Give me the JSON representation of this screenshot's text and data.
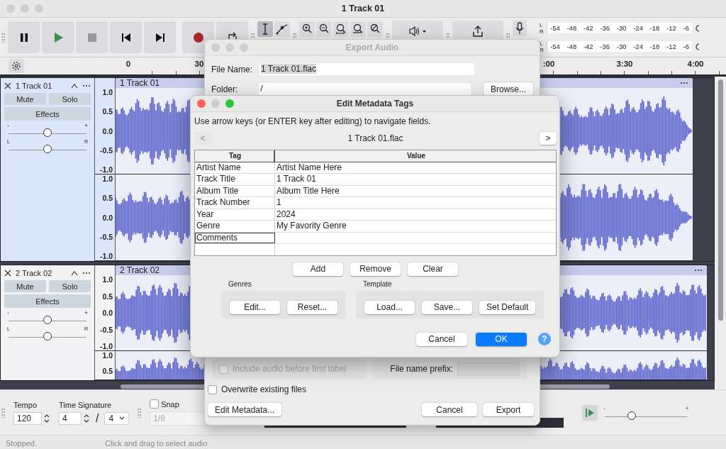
{
  "window": {
    "title": "1 Track 01"
  },
  "toolbar": {
    "transport": [
      {
        "kind": "pause"
      },
      {
        "kind": "play"
      },
      {
        "kind": "stop"
      },
      {
        "kind": "skip-start"
      },
      {
        "kind": "skip-end"
      },
      {
        "kind": "record"
      },
      {
        "kind": "loop"
      }
    ],
    "tools": [
      {
        "kind": "ibeam",
        "selected": true
      },
      {
        "kind": "envelope",
        "selected": false
      }
    ],
    "zoom": [
      {
        "kind": "zoom-in"
      },
      {
        "kind": "zoom-out"
      },
      {
        "kind": "fit-selection"
      },
      {
        "kind": "fit-project"
      },
      {
        "kind": "zoom-toggle"
      }
    ],
    "meters": [
      {
        "channels": [
          "L",
          "R"
        ],
        "scale": [
          "-54",
          "-48",
          "-42",
          "-36",
          "-30",
          "-24",
          "-18",
          "-12",
          "-6"
        ]
      },
      {
        "channels": [
          "L",
          "R"
        ],
        "scale": [
          "-54",
          "-48",
          "-42",
          "-36",
          "-30",
          "-24",
          "-18",
          "-12",
          "-6"
        ]
      }
    ]
  },
  "ruler": {
    "labels": [
      "0",
      "30",
      ":00",
      "3:30",
      "4:00"
    ]
  },
  "tracks": [
    {
      "name": "1 Track 01",
      "selected": true,
      "buttons": [
        "Mute",
        "Solo",
        "Effects"
      ],
      "gain_slider": {
        "min_label": "-",
        "max_label": "+",
        "level": 0.5
      },
      "pan_slider": {
        "min_label": "L",
        "max_label": "R",
        "level": 0.5
      },
      "clip_title": "1 Track 01",
      "channels": [
        {
          "scale": [
            "1.0",
            "0.5",
            "0.0",
            "-0.5",
            "-1.0"
          ]
        },
        {
          "scale": [
            "1.0",
            "0.5",
            "0.0",
            "-0.5",
            "-1.0"
          ]
        }
      ]
    },
    {
      "name": "2 Track 02",
      "selected": false,
      "buttons": [
        "Mute",
        "Solo",
        "Effects"
      ],
      "gain_slider": {
        "min_label": "-",
        "max_label": "+",
        "level": 0.5
      },
      "pan_slider": {
        "min_label": "L",
        "max_label": "R",
        "level": 0.5
      },
      "clip_title": "2 Track 02",
      "channels": [
        {
          "scale": [
            "1.0",
            "0.5",
            "0.0",
            "-0.5",
            "-1.0"
          ]
        },
        {
          "scale": [
            "1.0",
            "0.5"
          ]
        }
      ]
    }
  ],
  "bottom_bar": {
    "tempo": {
      "label": "Tempo",
      "value": "120"
    },
    "time_signature": {
      "label": "Time Signature",
      "upper": "4",
      "separator": "/",
      "lower": "4"
    },
    "snap": {
      "label": "Snap",
      "checked": false,
      "value": "1/8",
      "disabled": true
    },
    "play_speed": {
      "min_label": "-",
      "max_label": "+",
      "level": 0.33
    }
  },
  "status_bar": {
    "state": "Stopped.",
    "hint": "Click and drag to select audio"
  },
  "export_dialog": {
    "title": "Export Audio",
    "file_name_label": "File Name:",
    "file_name": "1 Track 01.flac",
    "folder_label": "Folder:",
    "folder": "/",
    "browse": "Browse...",
    "include_audio": {
      "label": "Include audio before first label",
      "checked": false,
      "disabled": true
    },
    "prefix_label": "File name prefix:",
    "overwrite": {
      "label": "Overwrite existing files",
      "checked": false
    },
    "edit_metadata": "Edit Metadata...",
    "cancel": "Cancel",
    "export": "Export"
  },
  "metadata_dialog": {
    "title": "Edit Metadata Tags",
    "hint": "Use arrow keys (or ENTER key after editing) to navigate fields.",
    "prev": {
      "label": "<",
      "disabled": true
    },
    "file": "1 Track 01.flac",
    "next": {
      "label": ">",
      "disabled": false
    },
    "columns": [
      "Tag",
      "Value"
    ],
    "rows": [
      {
        "tag": "Artist Name",
        "value": "Artist Name Here",
        "selected": false
      },
      {
        "tag": "Track Title",
        "value": "1 Track 01",
        "selected": false
      },
      {
        "tag": "Album Title",
        "value": "Album Title Here",
        "selected": false
      },
      {
        "tag": "Track Number",
        "value": "1",
        "selected": false
      },
      {
        "tag": "Year",
        "value": "2024",
        "selected": false
      },
      {
        "tag": "Genre",
        "value": "My Favority Genre",
        "selected": false
      },
      {
        "tag": "Comments",
        "selected": true
      }
    ],
    "actions": [
      "Add",
      "Remove",
      "Clear"
    ],
    "groups": [
      {
        "title": "Genres",
        "buttons": [
          "Edit...",
          "Reset..."
        ]
      },
      {
        "title": "Template",
        "buttons": [
          "Load...",
          "Save...",
          "Set Default"
        ]
      }
    ],
    "cancel": "Cancel",
    "ok": "OK",
    "help": "?"
  }
}
